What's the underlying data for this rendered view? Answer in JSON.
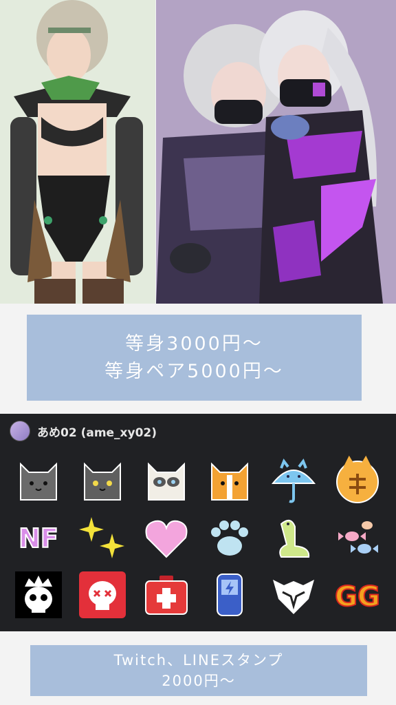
{
  "price_box": {
    "line1": "等身3000円〜",
    "line2": "等身ペア5000円〜"
  },
  "stamp_panel": {
    "username": "あめ02 (ame_xy02)",
    "stamps": [
      {
        "name": "gray-cat-emote"
      },
      {
        "name": "gray-cat-yellow-eyes-emote"
      },
      {
        "name": "siamese-cat-emote"
      },
      {
        "name": "orange-cat-emote"
      },
      {
        "name": "cat-umbrella-emote"
      },
      {
        "name": "orange-cat-kanji-emote"
      },
      {
        "name": "nf-text-emote",
        "text": "NF"
      },
      {
        "name": "sparkles-emote"
      },
      {
        "name": "pink-heart-emote"
      },
      {
        "name": "paw-print-emote"
      },
      {
        "name": "green-creature-emote"
      },
      {
        "name": "candy-emote"
      },
      {
        "name": "crowned-skull-emote"
      },
      {
        "name": "red-skull-emote"
      },
      {
        "name": "medkit-emote"
      },
      {
        "name": "shield-battery-emote"
      },
      {
        "name": "wolf-emblem-emote"
      },
      {
        "name": "gg-text-emote",
        "text": "GG"
      }
    ]
  },
  "footer_box": {
    "line1": "Twitch、LINEスタンプ",
    "line2": "2000円〜"
  },
  "colors": {
    "box_blue": "#a8bedb",
    "panel_dark": "#202124"
  }
}
